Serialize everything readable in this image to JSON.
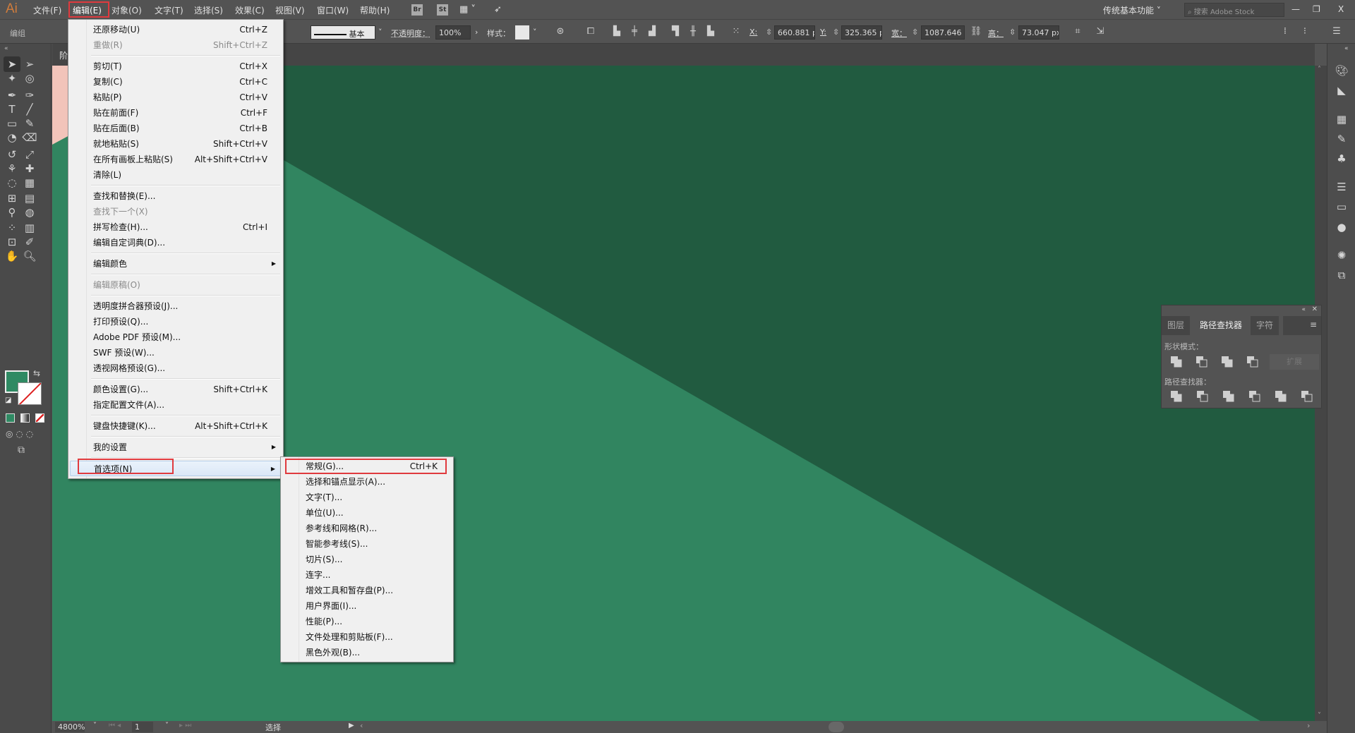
{
  "app": {
    "logo": "Ai"
  },
  "menubar": {
    "items": [
      "文件(F)",
      "编辑(E)",
      "对象(O)",
      "文字(T)",
      "选择(S)",
      "效果(C)",
      "视图(V)",
      "窗口(W)",
      "帮助(H)"
    ],
    "badges": [
      "Br",
      "St"
    ],
    "workspace": "传统基本功能",
    "search_placeholder": "搜索 Adobe Stock",
    "window_buttons": [
      "—",
      "❐",
      "X"
    ]
  },
  "control_bar": {
    "selection": "编组",
    "stroke_profile": "基本",
    "opacity_label": "不透明度：",
    "opacity_value": "100%",
    "style_label": "样式：",
    "x_label": "X:",
    "x_value": "660.881 p",
    "y_label": "Y:",
    "y_value": "325.365 p",
    "w_label": "宽：",
    "w_value": "1087.646",
    "h_label": "高：",
    "h_value": "73.047 px"
  },
  "document_tab": {
    "label": "阶"
  },
  "edit_menu": {
    "items": [
      {
        "label": "还原移动(U)",
        "shortcut": "Ctrl+Z"
      },
      {
        "label": "重做(R)",
        "shortcut": "Shift+Ctrl+Z",
        "disabled": true
      },
      {
        "sep": true
      },
      {
        "label": "剪切(T)",
        "shortcut": "Ctrl+X"
      },
      {
        "label": "复制(C)",
        "shortcut": "Ctrl+C"
      },
      {
        "label": "粘贴(P)",
        "shortcut": "Ctrl+V"
      },
      {
        "label": "贴在前面(F)",
        "shortcut": "Ctrl+F"
      },
      {
        "label": "贴在后面(B)",
        "shortcut": "Ctrl+B"
      },
      {
        "label": "就地粘贴(S)",
        "shortcut": "Shift+Ctrl+V"
      },
      {
        "label": "在所有画板上粘贴(S)",
        "shortcut": "Alt+Shift+Ctrl+V"
      },
      {
        "label": "清除(L)",
        "shortcut": ""
      },
      {
        "sep": true
      },
      {
        "label": "查找和替换(E)...",
        "shortcut": ""
      },
      {
        "label": "查找下一个(X)",
        "shortcut": "",
        "disabled": true
      },
      {
        "label": "拼写检查(H)...",
        "shortcut": "Ctrl+I"
      },
      {
        "label": "编辑自定词典(D)...",
        "shortcut": ""
      },
      {
        "sep": true
      },
      {
        "label": "编辑颜色",
        "shortcut": "",
        "submenu": true
      },
      {
        "sep": true
      },
      {
        "label": "编辑原稿(O)",
        "shortcut": "",
        "disabled": true
      },
      {
        "sep": true
      },
      {
        "label": "透明度拼合器预设(J)...",
        "shortcut": ""
      },
      {
        "label": "打印预设(Q)...",
        "shortcut": ""
      },
      {
        "label": "Adobe PDF 预设(M)...",
        "shortcut": ""
      },
      {
        "label": "SWF 预设(W)...",
        "shortcut": ""
      },
      {
        "label": "透视网格预设(G)...",
        "shortcut": ""
      },
      {
        "sep": true
      },
      {
        "label": "颜色设置(G)...",
        "shortcut": "Shift+Ctrl+K"
      },
      {
        "label": "指定配置文件(A)...",
        "shortcut": ""
      },
      {
        "sep": true
      },
      {
        "label": "键盘快捷键(K)...",
        "shortcut": "Alt+Shift+Ctrl+K"
      },
      {
        "sep": true
      },
      {
        "label": "我的设置",
        "shortcut": "",
        "submenu": true
      },
      {
        "sep": true
      },
      {
        "label": "首选项(N)",
        "shortcut": "",
        "submenu": true,
        "highlighted": true
      }
    ]
  },
  "preferences_submenu": {
    "items": [
      {
        "label": "常规(G)...",
        "shortcut": "Ctrl+K"
      },
      {
        "label": "选择和锚点显示(A)...",
        "shortcut": ""
      },
      {
        "label": "文字(T)...",
        "shortcut": ""
      },
      {
        "label": "单位(U)...",
        "shortcut": ""
      },
      {
        "label": "参考线和网格(R)...",
        "shortcut": ""
      },
      {
        "label": "智能参考线(S)...",
        "shortcut": ""
      },
      {
        "label": "切片(S)...",
        "shortcut": ""
      },
      {
        "label": "连字...",
        "shortcut": ""
      },
      {
        "label": "增效工具和暂存盘(P)...",
        "shortcut": ""
      },
      {
        "label": "用户界面(I)...",
        "shortcut": ""
      },
      {
        "label": "性能(P)...",
        "shortcut": ""
      },
      {
        "label": "文件处理和剪贴板(F)...",
        "shortcut": ""
      },
      {
        "label": "黑色外观(B)...",
        "shortcut": ""
      }
    ]
  },
  "pathfinder_panel": {
    "tabs": [
      "图层",
      "路径查找器",
      "字符"
    ],
    "active_tab": "路径查找器",
    "shape_modes_label": "形状模式：",
    "expand_label": "扩展",
    "pathfinders_label": "路径查找器："
  },
  "status_bar": {
    "zoom": "4800%",
    "page": "1",
    "status": "选择"
  },
  "colors": {
    "canvas_dark": "#215b40",
    "canvas_light": "#318560",
    "artboard_pink": "#f2c4ba",
    "fill_swatch": "#2f8a63",
    "highlight_red": "#e03a3e"
  },
  "tools": [
    "selection",
    "direct-selection",
    "magic-wand",
    "lasso",
    "pen",
    "curvature",
    "type",
    "line",
    "rectangle",
    "paintbrush",
    "shaper",
    "eraser",
    "rotate",
    "scale",
    "warp",
    "puppet-warp",
    "shape-builder",
    "perspective-grid",
    "mesh",
    "gradient",
    "eyedropper",
    "blend",
    "symbol-sprayer",
    "column-graph",
    "artboard",
    "slice",
    "hand",
    "zoom"
  ],
  "dock_icons": [
    "color-icon",
    "color-guide-icon",
    "swatches-icon",
    "brushes-icon",
    "symbols-icon",
    "stroke-icon",
    "gradient-icon",
    "transparency-icon",
    "appearance-icon",
    "graphic-styles-icon"
  ]
}
